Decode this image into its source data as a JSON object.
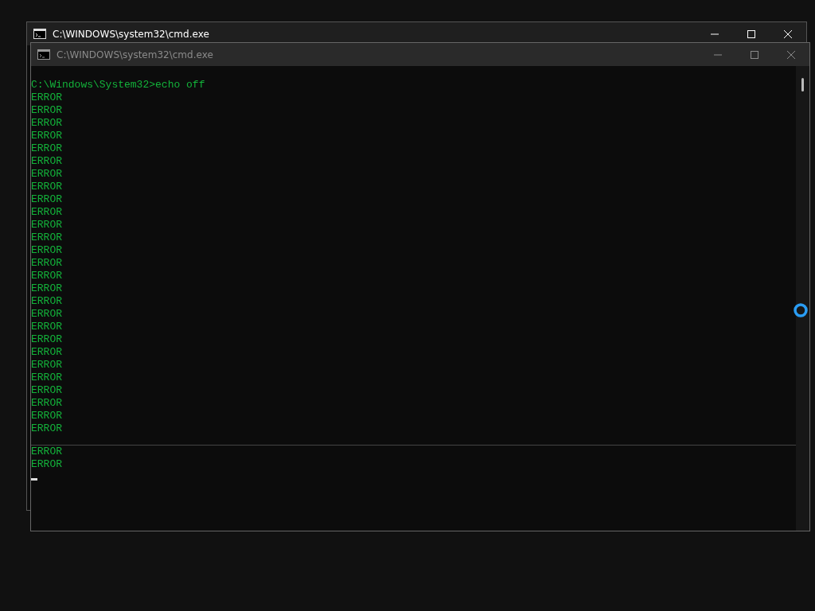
{
  "back_window": {
    "title": "C:\\WINDOWS\\system32\\cmd.exe",
    "active": true
  },
  "front_window": {
    "title": "C:\\WINDOWS\\system32\\cmd.exe",
    "active": false,
    "lines": [
      "C:\\Windows\\System32>echo off",
      "ERROR",
      "ERROR",
      "ERROR",
      "ERROR",
      "ERROR",
      "ERROR",
      "ERROR",
      "ERROR",
      "ERROR",
      "ERROR",
      "ERROR",
      "ERROR",
      "ERROR",
      "ERROR",
      "ERROR",
      "ERROR",
      "ERROR",
      "ERROR",
      "ERROR",
      "ERROR",
      "ERROR",
      "ERROR",
      "ERROR",
      "ERROR",
      "ERROR",
      "ERROR",
      "ERROR"
    ],
    "lines_below_divider": [
      "ERROR",
      "ERROR"
    ],
    "cursor_visible": true
  },
  "busy_pointer": true
}
